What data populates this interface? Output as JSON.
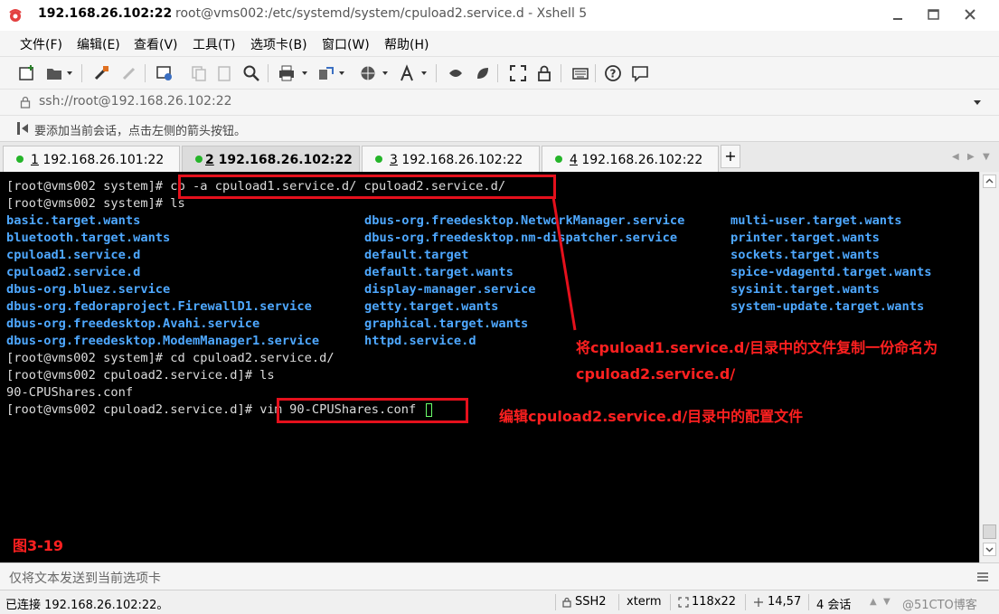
{
  "window": {
    "title_host": "192.168.26.102:22",
    "title_rest": "root@vms002:/etc/systemd/system/cpuload2.service.d - Xshell 5"
  },
  "menu": [
    "文件(F)",
    "编辑(E)",
    "查看(V)",
    "工具(T)",
    "选项卡(B)",
    "窗口(W)",
    "帮助(H)"
  ],
  "address": {
    "value": "ssh://root@192.168.26.102:22"
  },
  "hint": {
    "text": "要添加当前会话，点击左侧的箭头按钮。"
  },
  "tabs": [
    {
      "num": "1",
      "host": " 192.168.26.101:22"
    },
    {
      "num": "2",
      "host": " 192.168.26.102:22"
    },
    {
      "num": "3",
      "host": " 192.168.26.102:22"
    },
    {
      "num": "4",
      "host": " 192.168.26.102:22"
    }
  ],
  "tab_plus": "+",
  "terminal": {
    "prompt1": "[root@vms002 system]# ",
    "cmd1": "cp -a cpuload1.service.d/ cpuload2.service.d/",
    "line2": "[root@vms002 system]# ls",
    "ls_col1": [
      "basic.target.wants",
      "bluetooth.target.wants",
      "cpuload1.service.d",
      "cpuload2.service.d",
      "dbus-org.bluez.service",
      "dbus-org.fedoraproject.FirewallD1.service",
      "dbus-org.freedesktop.Avahi.service",
      "dbus-org.freedesktop.ModemManager1.service"
    ],
    "ls_col2": [
      "dbus-org.freedesktop.NetworkManager.service",
      "dbus-org.freedesktop.nm-dispatcher.service",
      "default.target",
      "default.target.wants",
      "display-manager.service",
      "getty.target.wants",
      "graphical.target.wants",
      "httpd.service.d"
    ],
    "ls_col3": [
      "multi-user.target.wants",
      "printer.target.wants",
      "sockets.target.wants",
      "spice-vdagentd.target.wants",
      "sysinit.target.wants",
      "system-update.target.wants"
    ],
    "line11": "[root@vms002 system]# cd cpuload2.service.d/",
    "line12": "[root@vms002 cpuload2.service.d]# ls",
    "line13": "90-CPUShares.conf",
    "prompt14": "[root@vms002 cpuload2.service.d]# ",
    "cmd14": "vim 90-CPUShares.conf "
  },
  "annotations": {
    "copy_line1": "将cpuload1.service.d/目录中的文件复制一份命名为",
    "copy_line2": "cpuload2.service.d/",
    "edit": "编辑cpuload2.service.d/目录中的配置文件",
    "figure": "图3-19"
  },
  "send_bar": {
    "placeholder": "仅将文本发送到当前选项卡"
  },
  "status": {
    "connected": "已连接 192.168.26.102:22。",
    "protocol": "SSH2",
    "term": "xterm",
    "size": "118x22",
    "pos": "14,57",
    "sessions": "4 会话",
    "watermark": "@51CTO博客"
  },
  "colors": {
    "accent_red": "#e5101c",
    "dir_blue": "#4ea8ff",
    "status_green": "#25b52a"
  }
}
